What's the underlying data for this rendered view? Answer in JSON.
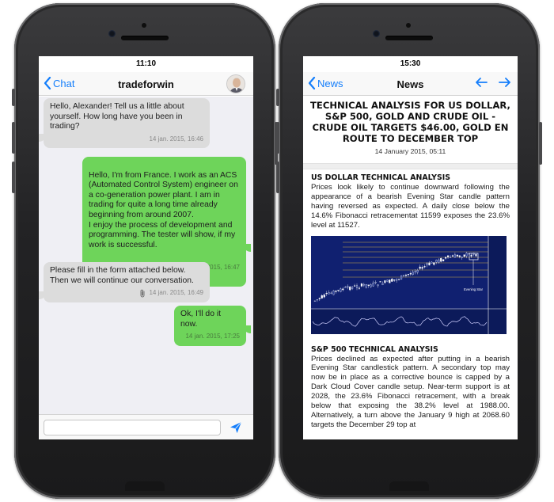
{
  "left_phone": {
    "status_time": "11:10",
    "nav": {
      "back_label": "Chat",
      "title": "tradeforwin"
    },
    "messages": [
      {
        "direction": "in",
        "text": "Hello, Alexander! Tell us a little about yourself. How long have you been in trading?",
        "timestamp": "14 jan. 2015, 16:46"
      },
      {
        "direction": "out",
        "text": "Hello, I'm from France. I work as an ACS (Automated Control System) engineer on a co-generation power plant. I am in trading for quite a long time already beginning from around 2007.\nI enjoy the process of development and programming. The tester will show, if my work is successful.",
        "timestamp": "14 jan. 2015, 16:47"
      },
      {
        "direction": "in",
        "text": "Please fill in the form attached below. Then we will continue our conversation.",
        "timestamp": "14 jan. 2015, 16:49",
        "attachment": "paperclip-icon"
      },
      {
        "direction": "out",
        "text": "Ok, I'll do it now.",
        "timestamp": "14 jan. 2015, 17:25"
      }
    ],
    "input": {
      "value": "",
      "placeholder": ""
    },
    "colors": {
      "accent": "#147efb",
      "incoming_bubble": "#dcdcdc",
      "outgoing_bubble": "#6ed45a"
    }
  },
  "right_phone": {
    "status_time": "15:30",
    "nav": {
      "back_label": "News",
      "title": "News"
    },
    "article": {
      "headline": "TECHNICAL ANALYSIS FOR US DOLLAR, S&P 500, GOLD AND CRUDE OIL - CRUDE OIL TARGETS $46.00, GOLD EN ROUTE TO DECEMBER TOP",
      "date": "14 January 2015, 05:11",
      "sections": [
        {
          "title": "US DOLLAR TECHNICAL ANALYSIS",
          "body": "Prices look likely to continue downward following the appearance of a bearish Evening Star candle pattern having reversed as expected. A daily close below the 14.6% Fibonacci retracementat 11599 exposes the 23.6% level at 11527."
        },
        {
          "title": "S&P 500 TECHNICAL ANALYSIS",
          "body": "Prices declined as expected after putting in a bearish Evening Star candlestick pattern. A secondary top may now be in place as a corrective bounce is capped by a Dark Cloud Cover candle setup. Near-term support is at 2028, the 23.6% Fibonacci retracement, with a break below that exposing the 38.2% level at 1988.00. Alternatively, a turn above the January 9 high at 2068.60 targets the December 29 top at"
        }
      ],
      "chart_annotation": "Evening Star"
    }
  }
}
